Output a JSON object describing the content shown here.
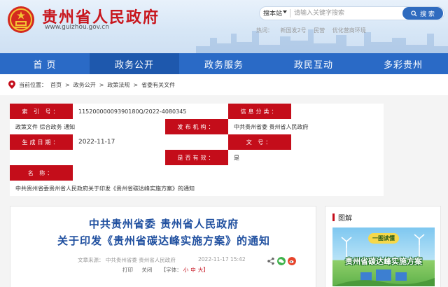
{
  "header": {
    "site_title": "贵州省人民政府",
    "site_url": "www.guizhou.gov.cn",
    "search_scope": "搜本站",
    "search_placeholder": "请输入关键字搜索",
    "search_button": "搜 索",
    "hot_words_label": "热词：",
    "hot_words": [
      "新国发2号",
      "民营",
      "优化营商环境"
    ]
  },
  "nav": {
    "items": [
      "首  页",
      "政务公开",
      "政务服务",
      "政民互动",
      "多彩贵州"
    ],
    "active_index": 1
  },
  "breadcrumb": {
    "label": "当前位置：",
    "items": [
      "首页",
      "政务公开",
      "政策法规",
      "省委有关文件"
    ],
    "separator": ">"
  },
  "info": {
    "index_label": "索 引 号：",
    "index_value": "11520000009390180Q/2022-4080345",
    "category_label": "信息分类：",
    "category_value": "政策文件  综合政务  通知",
    "publisher_label": "发布机构：",
    "publisher_value": "中共贵州省委 贵州省人民政府",
    "date_label": "生成日期：",
    "date_value": "2022-11-17",
    "docno_label": "文     号：",
    "docno_value": "",
    "valid_label": "是否有效：",
    "valid_value": "是",
    "name_label": "名     称：",
    "name_value": "中共贵州省委贵州省人民政府关于印发《贵州省碳达峰实施方案》的通知"
  },
  "article": {
    "title_line1": "中共贵州省委 贵州省人民政府",
    "title_line2": "关于印发《贵州省碳达峰实施方案》的通知",
    "source": "文章来源：  中共贵州省委 贵州省人民政府",
    "date": "2022-11-17 15:42",
    "print": "打印",
    "close": "关闭",
    "font_label": "【字体：",
    "font_small": "小",
    "font_medium": "中",
    "font_large": "大】"
  },
  "side": {
    "heading": "图解",
    "poster_badge": "一图读懂",
    "poster_title": "贵州省碳达峰实施方案"
  },
  "colors": {
    "brand_red": "#c8161d",
    "nav_blue": "#2a6ac6",
    "label_red": "#c40d1a",
    "title_blue": "#1f4f9f"
  }
}
